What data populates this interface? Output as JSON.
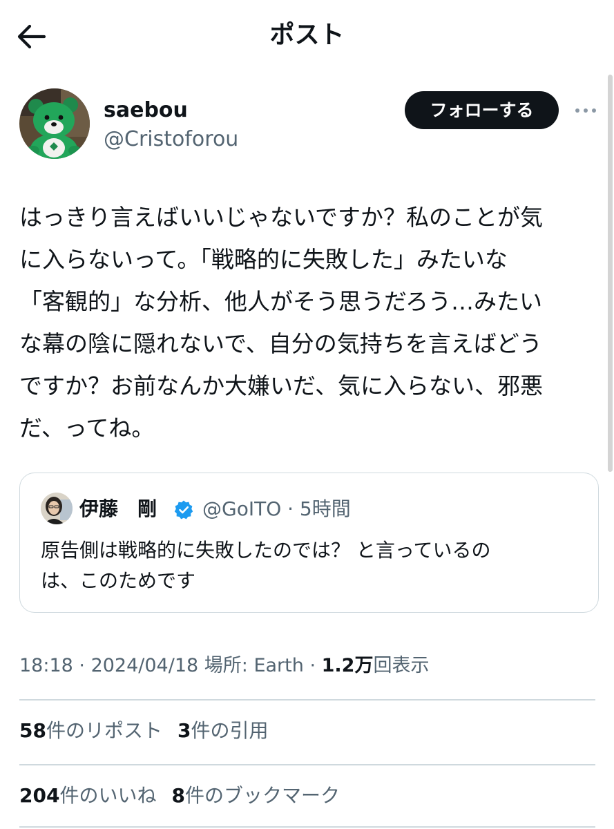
{
  "header": {
    "title": "ポスト",
    "back_icon": "arrow-left-icon"
  },
  "author": {
    "display_name": "saebou",
    "handle": "@Cristoforou",
    "follow_label": "フォローする",
    "more_icon": "ellipsis-icon"
  },
  "post": {
    "text_lines": [
      "はっきり言えばいいじゃないですか？私のことが気",
      "に入らないって。「戦略的に失敗した」みたいな",
      "「客観的」な分析、他人がそう思うだろう…みたい",
      "な幕の陰に隠れないで、自分の気持ちを言えばどう",
      "ですか？お前なんか大嫌いだ、気に入らない、邪悪",
      "だ、ってね。"
    ]
  },
  "quote": {
    "name": "伊藤　剛",
    "handle_time": "@GoITO · 5時間",
    "verified_icon": "verified-badge-icon",
    "text_lines": [
      "原告側は戦略的に失敗したのでは？ と言っているの",
      "は、このためです"
    ]
  },
  "meta": {
    "time": "18:18",
    "sep1": " · ",
    "date": "2024/04/18",
    "location": " 場所: Earth",
    "sep2": " · ",
    "views_count": "1.2万",
    "views_label": "回表示"
  },
  "stats": {
    "reposts_count": "58",
    "reposts_label": "件のリポスト",
    "quotes_count": "3",
    "quotes_label": "件の引用",
    "likes_count": "204",
    "likes_label": "件のいいね",
    "bookmarks_count": "8",
    "bookmarks_label": "件のブックマーク"
  },
  "colors": {
    "text_primary": "#0f1419",
    "text_secondary": "#536471",
    "border": "#cfd9de",
    "verified": "#1d9bf0"
  }
}
